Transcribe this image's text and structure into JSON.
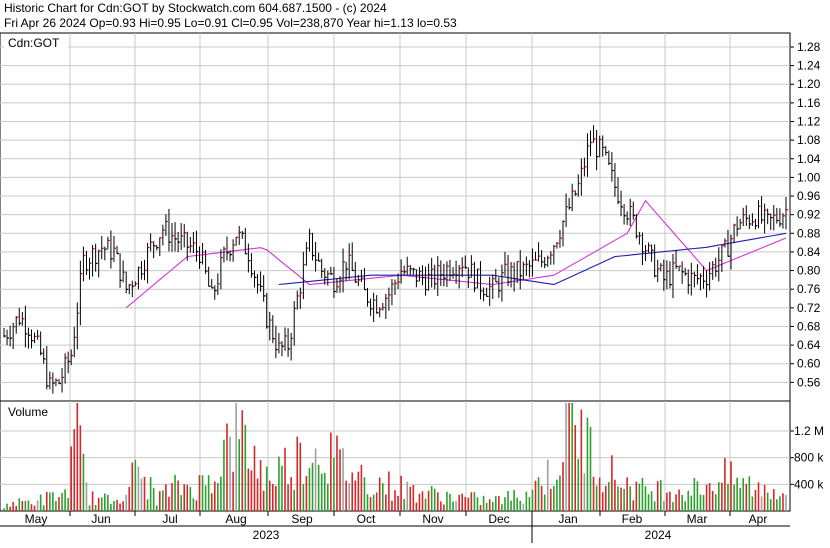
{
  "header": {
    "line1": "Historic Chart for Cdn:GOT by Stockwatch.com 604.687.1500 - (c) 2024",
    "line2": "Fri Apr 26 2024   Op=0.93  Hi=0.95  Lo=0.91  Cl=0.95  Vol=238,870  Year hi=1.13  lo=0.53"
  },
  "price_panel": {
    "symbol_label": "Cdn:GOT"
  },
  "volume_panel": {
    "label": "Volume"
  },
  "chart_data": [
    {
      "type": "line",
      "title": "Historic Chart for Cdn:GOT",
      "subtitle": "Fri Apr 26 2024 Op=0.93 Hi=0.95 Lo=0.91 Cl=0.95 Vol=238,870 Year hi=1.13 lo=0.53",
      "ylim": [
        0.52,
        1.31
      ],
      "y_ticks": [
        0.56,
        0.6,
        0.64,
        0.68,
        0.72,
        0.76,
        0.8,
        0.84,
        0.88,
        0.92,
        0.96,
        1.0,
        1.04,
        1.08,
        1.12,
        1.16,
        1.2,
        1.24,
        1.28
      ],
      "y_tick_labels": [
        "0.56",
        "0.60",
        "0.64",
        "0.68",
        "0.72",
        "0.76",
        "0.80",
        "0.84",
        "0.88",
        "0.92",
        "0.96",
        "1.00",
        "1.04",
        "1.08",
        "1.12",
        "1.16",
        "1.20",
        "1.24",
        "1.28"
      ],
      "x_tick_labels": [
        "May",
        "Jun",
        "Jul",
        "Aug",
        "Sep",
        "Oct",
        "Nov",
        "Dec",
        "Jan",
        "Feb",
        "Mar",
        "Apr"
      ],
      "year_labels": [
        "2023",
        "2024"
      ],
      "grid": true,
      "close_path": [
        [
          0,
          0.66
        ],
        [
          5,
          0.7
        ],
        [
          8,
          0.68
        ],
        [
          12,
          0.62
        ],
        [
          15,
          0.55
        ],
        [
          18,
          0.56
        ],
        [
          22,
          0.62
        ],
        [
          26,
          0.82
        ],
        [
          32,
          0.85
        ],
        [
          36,
          0.84
        ],
        [
          40,
          0.76
        ],
        [
          44,
          0.8
        ],
        [
          48,
          0.85
        ],
        [
          52,
          0.89
        ],
        [
          58,
          0.86
        ],
        [
          64,
          0.84
        ],
        [
          68,
          0.74
        ],
        [
          72,
          0.83
        ],
        [
          76,
          0.88
        ],
        [
          80,
          0.84
        ],
        [
          86,
          0.7
        ],
        [
          90,
          0.63
        ],
        [
          93,
          0.64
        ],
        [
          96,
          0.74
        ],
        [
          100,
          0.86
        ],
        [
          104,
          0.8
        ],
        [
          108,
          0.78
        ],
        [
          112,
          0.82
        ],
        [
          118,
          0.75
        ],
        [
          122,
          0.73
        ],
        [
          126,
          0.75
        ],
        [
          130,
          0.8
        ],
        [
          134,
          0.79
        ],
        [
          140,
          0.78
        ],
        [
          146,
          0.81
        ],
        [
          150,
          0.82
        ],
        [
          156,
          0.77
        ],
        [
          160,
          0.76
        ],
        [
          164,
          0.79
        ],
        [
          170,
          0.8
        ],
        [
          176,
          0.82
        ],
        [
          180,
          0.86
        ],
        [
          184,
          0.92
        ],
        [
          188,
          0.98
        ],
        [
          192,
          1.08
        ],
        [
          196,
          1.05
        ],
        [
          200,
          0.98
        ],
        [
          204,
          0.93
        ],
        [
          208,
          0.88
        ],
        [
          212,
          0.82
        ],
        [
          216,
          0.78
        ],
        [
          220,
          0.8
        ],
        [
          226,
          0.78
        ],
        [
          230,
          0.79
        ],
        [
          236,
          0.84
        ],
        [
          240,
          0.9
        ],
        [
          246,
          0.92
        ],
        [
          250,
          0.9
        ],
        [
          256,
          0.93
        ]
      ],
      "moving_averages": [
        {
          "window": 50,
          "values": [
            [
              40,
              0.72
            ],
            [
              60,
              0.83
            ],
            [
              85,
              0.85
            ],
            [
              100,
              0.77
            ],
            [
              130,
              0.79
            ],
            [
              160,
              0.77
            ],
            [
              180,
              0.79
            ],
            [
              204,
              0.88
            ],
            [
              210,
              0.95
            ],
            [
              230,
              0.8
            ],
            [
              256,
              0.87
            ]
          ]
        },
        {
          "window": 100,
          "values": [
            [
              90,
              0.77
            ],
            [
              120,
              0.79
            ],
            [
              160,
              0.79
            ],
            [
              180,
              0.77
            ],
            [
              200,
              0.83
            ],
            [
              230,
              0.85
            ],
            [
              256,
              0.88
            ]
          ]
        }
      ]
    },
    {
      "type": "bar",
      "title": "Volume",
      "y_ticks": [
        400000,
        800000,
        1200000
      ],
      "y_tick_labels": [
        "400 k",
        "800 k",
        "1.2 M"
      ],
      "ylim": [
        0,
        1650000
      ],
      "series_colors": {
        "up": "#2ca02c",
        "down": "#d62728",
        "unchanged": "#a0a0a0"
      },
      "volume_profile": [
        [
          0,
          100000
        ],
        [
          10,
          150000
        ],
        [
          20,
          250000
        ],
        [
          24,
          1100000
        ],
        [
          28,
          200000
        ],
        [
          36,
          150000
        ],
        [
          44,
          600000
        ],
        [
          50,
          200000
        ],
        [
          56,
          350000
        ],
        [
          66,
          400000
        ],
        [
          76,
          1200000
        ],
        [
          86,
          500000
        ],
        [
          96,
          800000
        ],
        [
          104,
          950000
        ],
        [
          110,
          700000
        ],
        [
          120,
          450000
        ],
        [
          130,
          350000
        ],
        [
          140,
          250000
        ],
        [
          150,
          200000
        ],
        [
          160,
          150000
        ],
        [
          170,
          250000
        ],
        [
          180,
          600000
        ],
        [
          186,
          1400000
        ],
        [
          192,
          900000
        ],
        [
          200,
          500000
        ],
        [
          210,
          300000
        ],
        [
          216,
          350000
        ],
        [
          224,
          300000
        ],
        [
          236,
          500000
        ],
        [
          246,
          350000
        ],
        [
          256,
          300000
        ]
      ]
    }
  ],
  "colors": {
    "bar_up": "#cc0000",
    "bar_down": "#000000",
    "ma_short": "#d633d6",
    "ma_long": "#1f1fb0",
    "grid": "#c8c8c8",
    "frame": "#000000"
  }
}
